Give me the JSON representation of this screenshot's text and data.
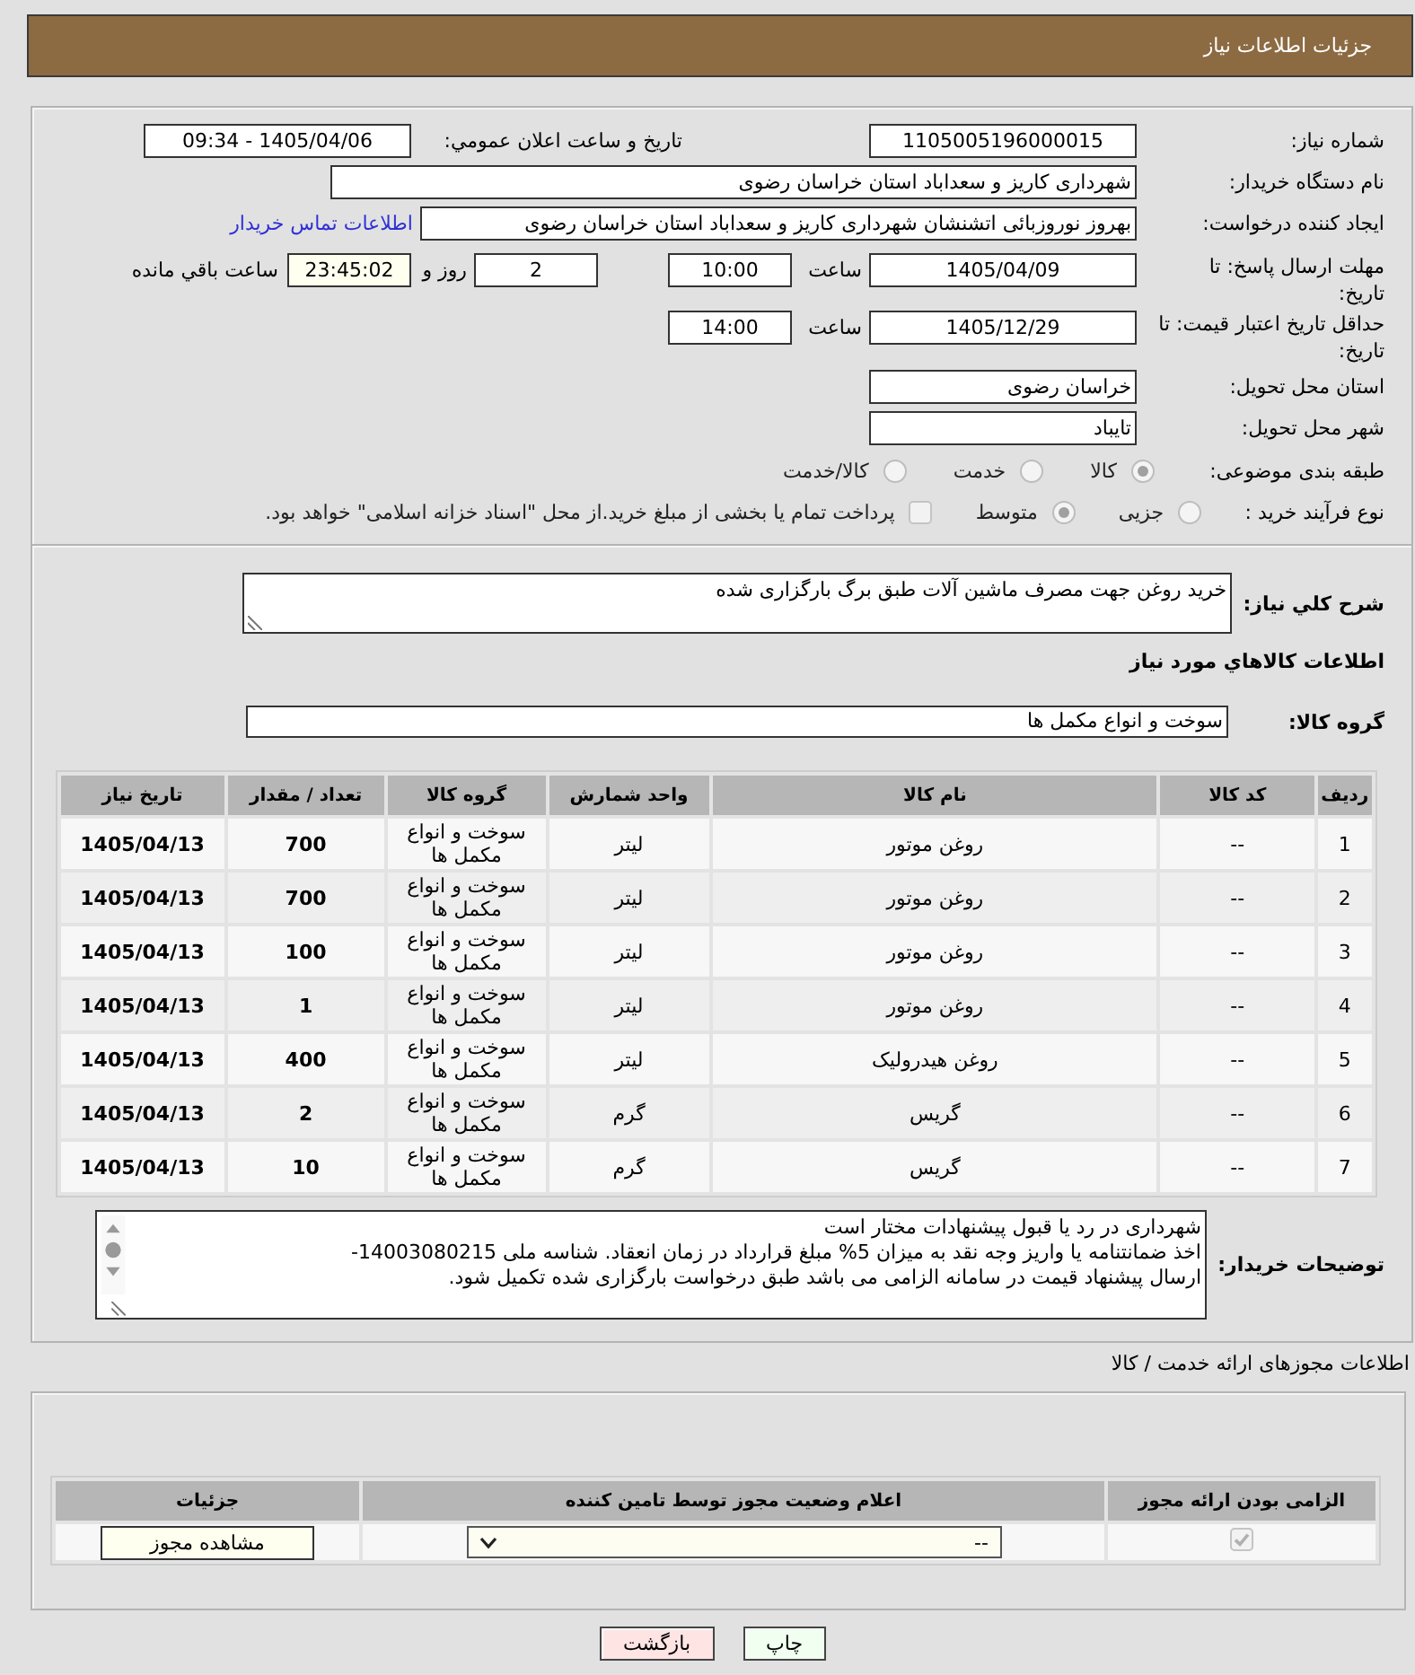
{
  "header": {
    "title": "جزئیات اطلاعات نیاز"
  },
  "details": {
    "need_number": {
      "label": "شماره نیاز:",
      "value": "1105005196000015"
    },
    "announce": {
      "label": "تاریخ و ساعت اعلان عمومي:",
      "value": "1405/04/06 - 09:34"
    },
    "buyer": {
      "label": "نام دستگاه خریدار:",
      "value": "شهرداری کاریز و سعداباد استان خراسان رضوی"
    },
    "requester": {
      "label": "ایجاد کننده درخواست:",
      "value": "بهروز نوروزبائی اتشنشان شهرداری کاریز و سعداباد استان خراسان رضوی",
      "contact_link": "اطلاعات تماس خریدار"
    },
    "deadline": {
      "label": "مهلت ارسال پاسخ: تا تاریخ:",
      "date": "1405/04/09",
      "time_label": "ساعت",
      "time": "10:00",
      "days": "2",
      "days_label": "روز و",
      "remaining": "23:45:02",
      "remaining_label": "ساعت باقي مانده"
    },
    "price_validity": {
      "label": "حداقل تاریخ اعتبار قیمت: تا تاریخ:",
      "date": "1405/12/29",
      "time_label": "ساعت",
      "time": "14:00"
    },
    "province": {
      "label": "استان محل تحویل:",
      "value": "خراسان رضوی"
    },
    "city": {
      "label": "شهر محل تحویل:",
      "value": "تایباد"
    },
    "category": {
      "label": "طبقه بندی موضوعی:",
      "options": [
        {
          "label": "کالا",
          "selected": true
        },
        {
          "label": "خدمت",
          "selected": false
        },
        {
          "label": "کالا/خدمت",
          "selected": false
        }
      ]
    },
    "process": {
      "label": "نوع فرآیند خرید :",
      "options": [
        {
          "label": "جزیی",
          "selected": false
        },
        {
          "label": "متوسط",
          "selected": true
        }
      ],
      "treasury": {
        "label": "پرداخت تمام یا بخشی از مبلغ خرید.از محل \"اسناد خزانه اسلامی\" خواهد بود.",
        "checked": false
      }
    }
  },
  "summary": {
    "label": "شرح کلي نياز:",
    "value": "خرید روغن جهت مصرف ماشین آلات طبق برگ بارگزاری شده"
  },
  "goods": {
    "title": "اطلاعات کالاهاي مورد نياز",
    "group": {
      "label": "گروه کالا:",
      "value": "سوخت و انواع مکمل ها"
    },
    "columns": [
      "ردیف",
      "کد کالا",
      "نام کالا",
      "واحد شمارش",
      "گروه کالا",
      "تعداد / مقدار",
      "تاریخ نیاز"
    ],
    "rows": [
      [
        "1",
        "--",
        "روغن موتور",
        "لیتر",
        "سوخت و انواع مکمل ها",
        "700",
        "1405/04/13"
      ],
      [
        "2",
        "--",
        "روغن موتور",
        "لیتر",
        "سوخت و انواع مکمل ها",
        "700",
        "1405/04/13"
      ],
      [
        "3",
        "--",
        "روغن موتور",
        "لیتر",
        "سوخت و انواع مکمل ها",
        "100",
        "1405/04/13"
      ],
      [
        "4",
        "--",
        "روغن موتور",
        "لیتر",
        "سوخت و انواع مکمل ها",
        "1",
        "1405/04/13"
      ],
      [
        "5",
        "--",
        "روغن هیدرولیک",
        "لیتر",
        "سوخت و انواع مکمل ها",
        "400",
        "1405/04/13"
      ],
      [
        "6",
        "--",
        "گریس",
        "گرم",
        "سوخت و انواع مکمل ها",
        "2",
        "1405/04/13"
      ],
      [
        "7",
        "--",
        "گریس",
        "گرم",
        "سوخت و انواع مکمل ها",
        "10",
        "1405/04/13"
      ]
    ]
  },
  "buyer_notes": {
    "label": "توضیحات خریدار:",
    "value": "شهرداری در رد یا قبول پیشنهادات مختار است\nاخذ ضمانتنامه یا واریز وجه نقد به میزان 5% مبلغ قرارداد در زمان انعقاد. شناسه ملی 14003080215-\nارسال پیشنهاد قیمت در سامانه الزامی می باشد طبق درخواست بارگزاری شده تکمیل شود."
  },
  "permits": {
    "title": "اطلاعات مجوزهای ارائه خدمت / کالا",
    "columns": [
      "الزامی بودن ارائه مجوز",
      "اعلام وضعیت مجوز توسط تامین کننده",
      "جزئیات"
    ],
    "rows": [
      {
        "checked": true,
        "status": "--",
        "view_button": "مشاهده مجوز"
      }
    ]
  },
  "buttons": [
    {
      "label": "چاپ",
      "kind": "print"
    },
    {
      "label": "بازگشت",
      "kind": "back"
    }
  ]
}
